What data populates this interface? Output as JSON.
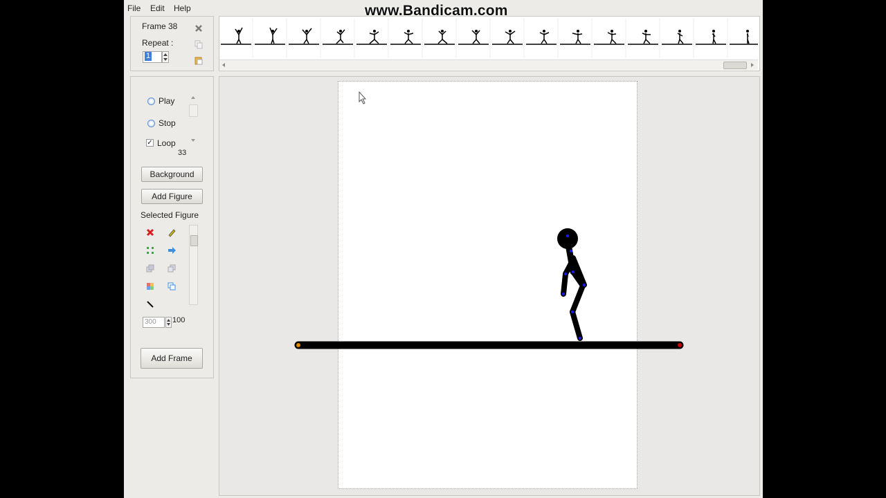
{
  "watermark": "www.Bandicam.com",
  "menu": [
    "File",
    "Edit",
    "Help"
  ],
  "frame": {
    "title": "Frame 38",
    "repeat_label": "Repeat :",
    "repeat_value": "1"
  },
  "controls": {
    "play": "Play",
    "stop": "Stop",
    "loop": "Loop",
    "loop_checked": true,
    "fps": "33",
    "background": "Background",
    "add_figure": "Add Figure",
    "selected_figure": "Selected Figure",
    "size_value": "300",
    "opacity_value": "100",
    "add_frame": "Add Frame"
  },
  "timeline": {
    "thumbnail_count": 16
  },
  "colors": {
    "accent": "#5b8ed6",
    "figure": "#000000",
    "joint": "#1a1aff",
    "joint_red": "#cc0000",
    "joint_orange": "#e08a00"
  }
}
